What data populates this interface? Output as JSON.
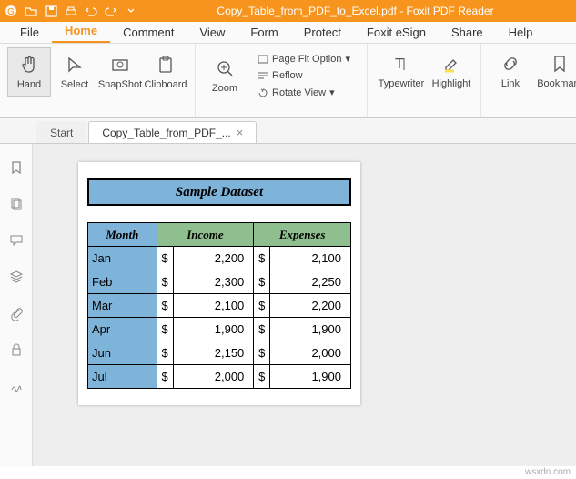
{
  "titlebar": {
    "filename": "Copy_Table_from_PDF_to_Excel.pdf",
    "app": "Foxit PDF Reader"
  },
  "menubar": [
    "File",
    "Home",
    "Comment",
    "View",
    "Form",
    "Protect",
    "Foxit eSign",
    "Share",
    "Help"
  ],
  "menubar_active": 1,
  "ribbon": {
    "hand": "Hand",
    "select": "Select",
    "snapshot": "SnapShot",
    "clipboard": "Clipboard",
    "zoom": "Zoom",
    "page_fit": "Page Fit Option",
    "reflow": "Reflow",
    "rotate": "Rotate View",
    "typewriter": "Typewriter",
    "highlight": "Highlight",
    "link": "Link",
    "bookmark": "Bookmark"
  },
  "doc_tabs": {
    "start": "Start",
    "file": "Copy_Table_from_PDF_..."
  },
  "dataset": {
    "title": "Sample Dataset",
    "headers": {
      "month": "Month",
      "income": "Income",
      "expenses": "Expenses"
    },
    "currency": "$",
    "rows": [
      {
        "month": "Jan",
        "income": "2,200",
        "expenses": "2,100"
      },
      {
        "month": "Feb",
        "income": "2,300",
        "expenses": "2,250"
      },
      {
        "month": "Mar",
        "income": "2,100",
        "expenses": "2,200"
      },
      {
        "month": "Apr",
        "income": "1,900",
        "expenses": "1,900"
      },
      {
        "month": "Jun",
        "income": "2,150",
        "expenses": "2,000"
      },
      {
        "month": "Jul",
        "income": "2,000",
        "expenses": "1,900"
      }
    ]
  },
  "chart_data": {
    "type": "table",
    "title": "Sample Dataset",
    "columns": [
      "Month",
      "Income",
      "Expenses"
    ],
    "rows": [
      [
        "Jan",
        2200,
        2100
      ],
      [
        "Feb",
        2300,
        2250
      ],
      [
        "Mar",
        2100,
        2200
      ],
      [
        "Apr",
        1900,
        1900
      ],
      [
        "Jun",
        2150,
        2000
      ],
      [
        "Jul",
        2000,
        1900
      ]
    ],
    "currency": "$"
  },
  "watermark": "wsxdn.com"
}
